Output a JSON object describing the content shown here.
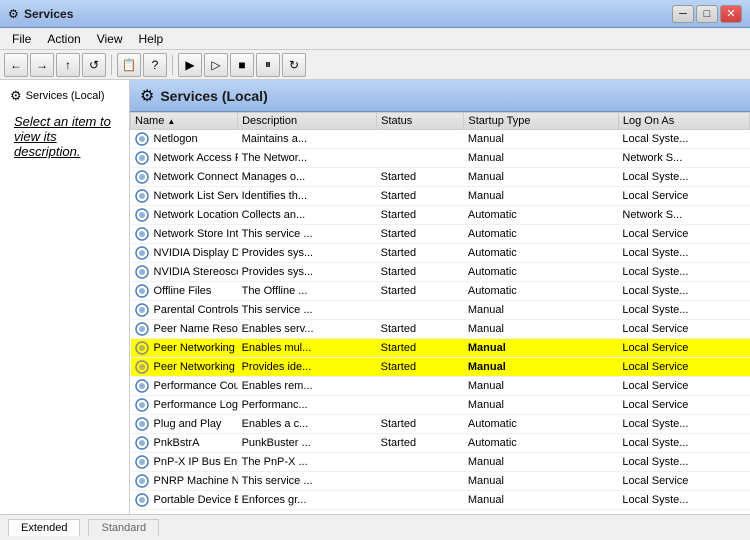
{
  "window": {
    "title": "Services"
  },
  "titlebar": {
    "minimize_label": "─",
    "restore_label": "□",
    "close_label": "✕"
  },
  "menu": {
    "items": [
      "File",
      "Action",
      "View",
      "Help"
    ]
  },
  "toolbar": {
    "buttons": [
      "←",
      "→",
      "⊞",
      "↺",
      "🔍",
      "|",
      "📋",
      "|",
      "▶",
      "▶▶",
      "■",
      "⏸",
      "⏩"
    ]
  },
  "left_panel": {
    "item_label": "Services (Local)"
  },
  "description": {
    "text": "Select an item to view its",
    "text2": "description."
  },
  "services_header": "Services (Local)",
  "columns": [
    "Name",
    "Description",
    "Status",
    "Startup Type",
    "Log On As"
  ],
  "services": [
    {
      "name": "Netlogon",
      "desc": "Maintains a...",
      "status": "",
      "startup": "Manual",
      "logon": "Local Syste...",
      "highlight": false
    },
    {
      "name": "Network Access P...",
      "desc": "The Networ...",
      "status": "",
      "startup": "Manual",
      "logon": "Network S...",
      "highlight": false
    },
    {
      "name": "Network Connecti...",
      "desc": "Manages o...",
      "status": "Started",
      "startup": "Manual",
      "logon": "Local Syste...",
      "highlight": false
    },
    {
      "name": "Network List Service",
      "desc": "Identifies th...",
      "status": "Started",
      "startup": "Manual",
      "logon": "Local Service",
      "highlight": false
    },
    {
      "name": "Network Location ...",
      "desc": "Collects an...",
      "status": "Started",
      "startup": "Automatic",
      "logon": "Network S...",
      "highlight": false
    },
    {
      "name": "Network Store Int...",
      "desc": "This service ...",
      "status": "Started",
      "startup": "Automatic",
      "logon": "Local Service",
      "highlight": false
    },
    {
      "name": "NVIDIA Display Dri...",
      "desc": "Provides sys...",
      "status": "Started",
      "startup": "Automatic",
      "logon": "Local Syste...",
      "highlight": false
    },
    {
      "name": "NVIDIA Stereosco...",
      "desc": "Provides sys...",
      "status": "Started",
      "startup": "Automatic",
      "logon": "Local Syste...",
      "highlight": false
    },
    {
      "name": "Offline Files",
      "desc": "The Offline ...",
      "status": "Started",
      "startup": "Automatic",
      "logon": "Local Syste...",
      "highlight": false
    },
    {
      "name": "Parental Controls",
      "desc": "This service ...",
      "status": "",
      "startup": "Manual",
      "logon": "Local Syste...",
      "highlight": false
    },
    {
      "name": "Peer Name Resolu...",
      "desc": "Enables serv...",
      "status": "Started",
      "startup": "Manual",
      "logon": "Local Service",
      "highlight": false
    },
    {
      "name": "Peer Networking ...",
      "desc": "Enables mul...",
      "status": "Started",
      "startup": "Manual",
      "logon": "Local Service",
      "highlight": true
    },
    {
      "name": "Peer Networking I...",
      "desc": "Provides ide...",
      "status": "Started",
      "startup": "Manual",
      "logon": "Local Service",
      "highlight": true
    },
    {
      "name": "Performance Cou...",
      "desc": "Enables rem...",
      "status": "",
      "startup": "Manual",
      "logon": "Local Service",
      "highlight": false
    },
    {
      "name": "Performance Logs...",
      "desc": "Performanc...",
      "status": "",
      "startup": "Manual",
      "logon": "Local Service",
      "highlight": false
    },
    {
      "name": "Plug and Play",
      "desc": "Enables a c...",
      "status": "Started",
      "startup": "Automatic",
      "logon": "Local Syste...",
      "highlight": false
    },
    {
      "name": "PnkBstrA",
      "desc": "PunkBuster ...",
      "status": "Started",
      "startup": "Automatic",
      "logon": "Local Syste...",
      "highlight": false
    },
    {
      "name": "PnP-X IP Bus Enu...",
      "desc": "The PnP-X ...",
      "status": "",
      "startup": "Manual",
      "logon": "Local Syste...",
      "highlight": false
    },
    {
      "name": "PNRP Machine Na...",
      "desc": "This service ...",
      "status": "",
      "startup": "Manual",
      "logon": "Local Service",
      "highlight": false
    },
    {
      "name": "Portable Device E...",
      "desc": "Enforces gr...",
      "status": "",
      "startup": "Manual",
      "logon": "Local Syste...",
      "highlight": false
    }
  ],
  "status_tabs": [
    "Extended",
    "Standard"
  ]
}
